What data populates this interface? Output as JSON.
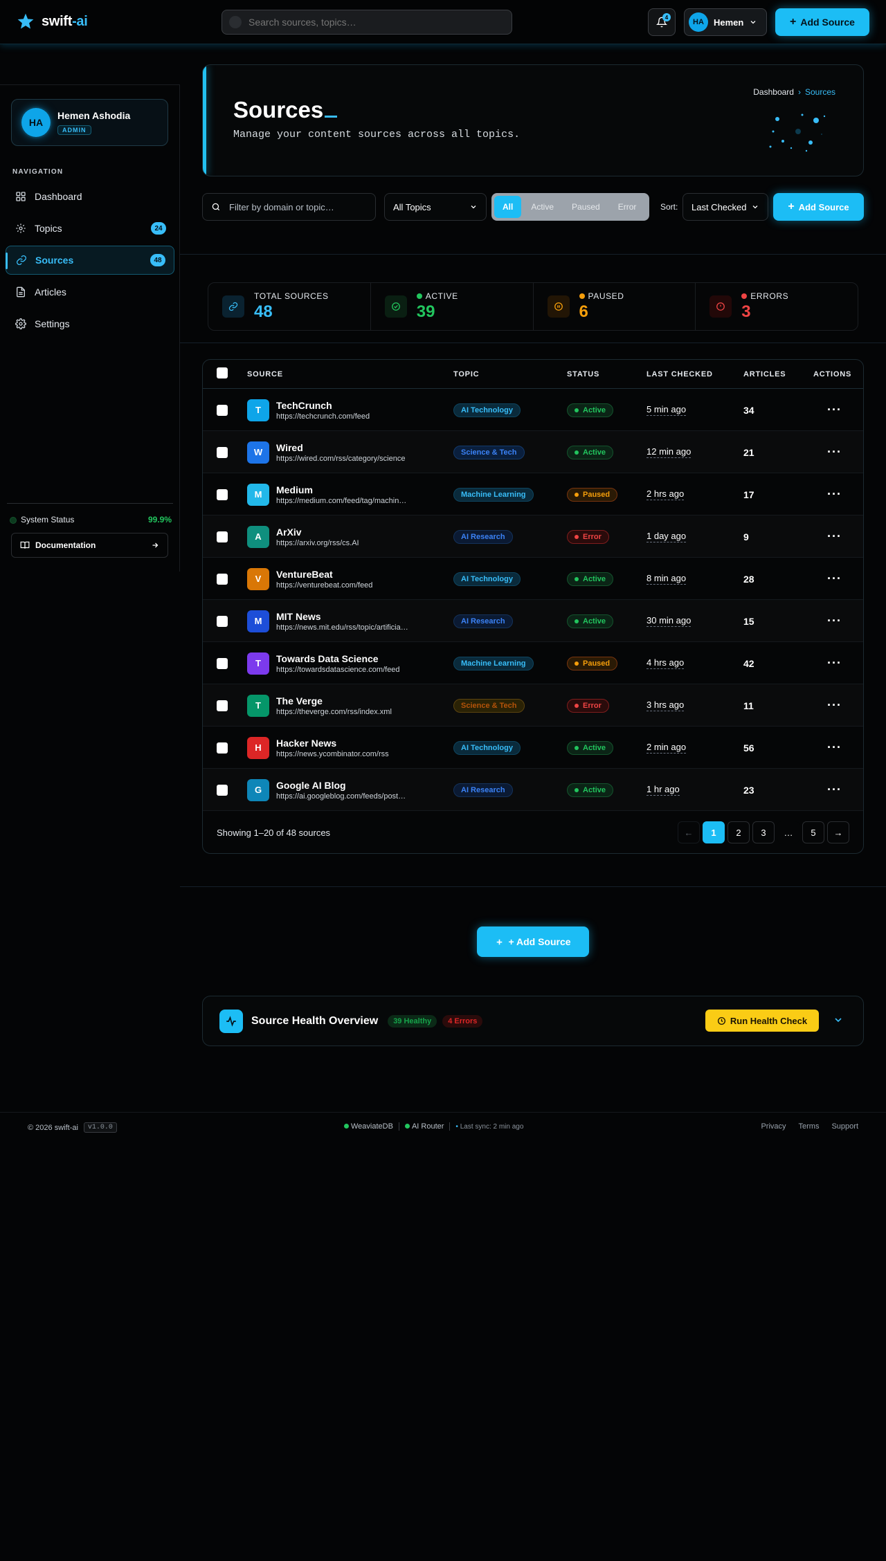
{
  "app": {
    "logo_main": "swift",
    "logo_accent": "-ai"
  },
  "topbar": {
    "search_placeholder": "Search sources, topics…",
    "notification_count": "4",
    "user_initials": "HA",
    "user_name": "Hemen",
    "add_label": "Add Source"
  },
  "sidebar": {
    "profile_initials": "HA",
    "profile_name": "Hemen Ashodia",
    "profile_role": "ADMIN",
    "nav_label": "NAVIGATION",
    "items": [
      {
        "label": "Dashboard",
        "icon": "grid-icon",
        "badge": ""
      },
      {
        "label": "Topics",
        "icon": "topics-icon",
        "badge": "24"
      },
      {
        "label": "Sources",
        "icon": "link-icon",
        "badge": "48",
        "active": true
      },
      {
        "label": "Articles",
        "icon": "file-icon",
        "badge": ""
      },
      {
        "label": "Settings",
        "icon": "gear-icon",
        "badge": ""
      }
    ],
    "system_status_label": "System Status",
    "system_status_value": "99.9%",
    "docs_label": "Documentation"
  },
  "header": {
    "title": "Sources",
    "subtitle": "Manage your content sources across all topics.",
    "breadcrumb_home": "Dashboard",
    "breadcrumb_sep": "›",
    "breadcrumb_current": "Sources"
  },
  "filters": {
    "domain_placeholder": "Filter by domain or topic…",
    "topic_selected": "All Topics",
    "segments": [
      "All",
      "Active",
      "Paused",
      "Error"
    ],
    "segment_active": "All",
    "sort_label": "Sort:",
    "sort_selected": "Last Checked",
    "add_label": "Add Source"
  },
  "stats": [
    {
      "label": "TOTAL SOURCES",
      "value": "48",
      "color": "#38bdf8",
      "icon": "link-icon"
    },
    {
      "label": "ACTIVE",
      "value": "39",
      "color": "#22c55e",
      "icon": "check-circle-icon"
    },
    {
      "label": "PAUSED",
      "value": "6",
      "color": "#f59e0b",
      "icon": "pause-circle-icon"
    },
    {
      "label": "ERRORS",
      "value": "3",
      "color": "#ef4444",
      "icon": "alert-circle-icon"
    }
  ],
  "table": {
    "columns": [
      "SOURCE",
      "TOPIC",
      "STATUS",
      "LAST CHECKED",
      "ARTICLES",
      "ACTIONS"
    ],
    "rows": [
      {
        "letter": "T",
        "color": "#0ea5e9",
        "name": "TechCrunch",
        "url": "https://techcrunch.com/feed",
        "topic": "AI Technology",
        "status": "Active",
        "checked": "5 min ago",
        "articles": "34"
      },
      {
        "letter": "W",
        "color": "#1d74e8",
        "name": "Wired",
        "url": "https://wired.com/rss/category/science",
        "topic": "Science & Tech",
        "status": "Active",
        "checked": "12 min ago",
        "articles": "21"
      },
      {
        "letter": "M",
        "color": "#22b8ea",
        "name": "Medium",
        "url": "https://medium.com/feed/tag/machin…",
        "topic": "Machine Learning",
        "status": "Paused",
        "checked": "2 hrs ago",
        "articles": "17"
      },
      {
        "letter": "A",
        "color": "#0f8f7e",
        "name": "ArXiv",
        "url": "https://arxiv.org/rss/cs.AI",
        "topic": "AI Research",
        "status": "Error",
        "checked": "1 day ago",
        "articles": "9"
      },
      {
        "letter": "V",
        "color": "#d97706",
        "name": "VentureBeat",
        "url": "https://venturebeat.com/feed",
        "topic": "AI Technology",
        "status": "Active",
        "checked": "8 min ago",
        "articles": "28"
      },
      {
        "letter": "M",
        "color": "#1d4ed8",
        "name": "MIT News",
        "url": "https://news.mit.edu/rss/topic/artificia…",
        "topic": "AI Research",
        "status": "Active",
        "checked": "30 min ago",
        "articles": "15"
      },
      {
        "letter": "T",
        "color": "#7c3aed",
        "name": "Towards Data Science",
        "url": "https://towardsdatascience.com/feed",
        "topic": "Machine Learning",
        "status": "Paused",
        "checked": "4 hrs ago",
        "articles": "42"
      },
      {
        "letter": "T",
        "color": "#059669",
        "name": "The Verge",
        "url": "https://theverge.com/rss/index.xml",
        "topic": "Science & Tech",
        "status": "Error",
        "checked": "3 hrs ago",
        "articles": "11"
      },
      {
        "letter": "H",
        "color": "#dc2626",
        "name": "Hacker News",
        "url": "https://news.ycombinator.com/rss",
        "topic": "AI Technology",
        "status": "Active",
        "checked": "2 min ago",
        "articles": "56"
      },
      {
        "letter": "G",
        "color": "#0e86b8",
        "name": "Google AI Blog",
        "url": "https://ai.googleblog.com/feeds/post…",
        "topic": "AI Research",
        "status": "Active",
        "checked": "1 hr ago",
        "articles": "23"
      }
    ],
    "showing": "Showing 1–20 of 48 sources",
    "pages": [
      "←",
      "1",
      "2",
      "3",
      "…",
      "5",
      "→"
    ],
    "current_page": "1"
  },
  "bottom_add_label": "+ Add Source",
  "health": {
    "title": "Source Health Overview",
    "healthy": "39 Healthy",
    "errors": "4 Errors",
    "run_label": "Run Health Check"
  },
  "footer": {
    "copyright": "© 2026 swift-ai",
    "version": "v1.0.0",
    "db": "WeaviateDB",
    "router": "AI Router",
    "sync": "Last sync: 2 min ago",
    "links": [
      "Privacy",
      "Terms",
      "Support"
    ]
  }
}
